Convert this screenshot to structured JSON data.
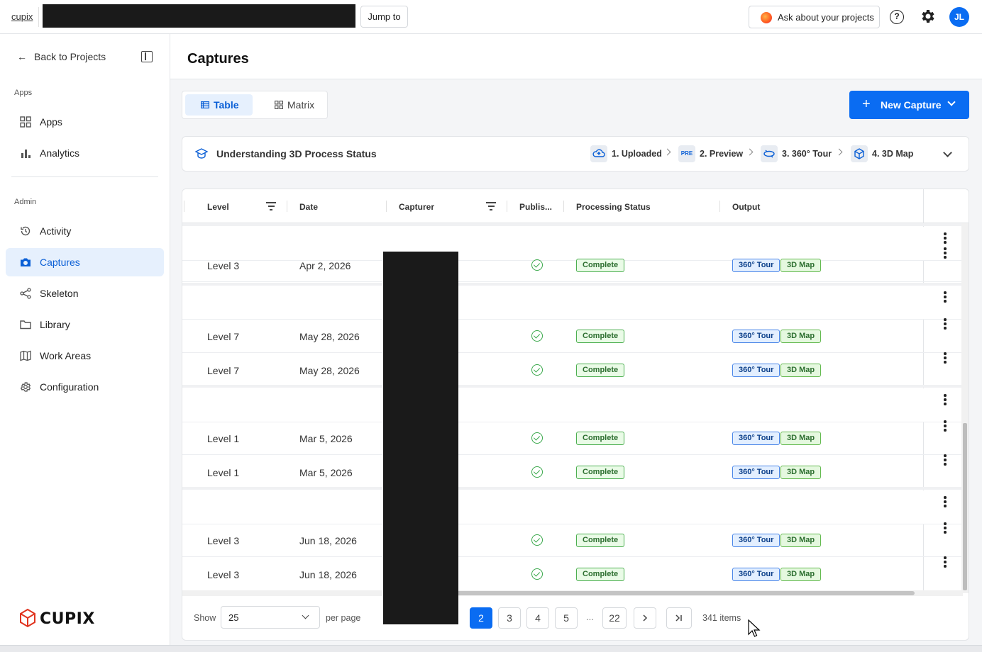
{
  "topbar": {
    "breadcrumb": "cupix",
    "jump_label": "Jump to",
    "ask_label": "Ask about your projects",
    "help_glyph": "?",
    "avatar_initials": "JL"
  },
  "sidebar": {
    "back_label": "Back to Projects",
    "sections": [
      {
        "title": "Apps",
        "items": [
          {
            "label": "Apps",
            "icon": "grid-icon"
          },
          {
            "label": "Analytics",
            "icon": "bar-chart-icon"
          }
        ]
      },
      {
        "title": "Admin",
        "items": [
          {
            "label": "Activity",
            "icon": "history-icon"
          },
          {
            "label": "Captures",
            "icon": "camera-icon",
            "active": true
          },
          {
            "label": "Skeleton",
            "icon": "share-icon"
          },
          {
            "label": "Library",
            "icon": "folder-icon"
          },
          {
            "label": "Work Areas",
            "icon": "map-icon"
          },
          {
            "label": "Configuration",
            "icon": "gear-icon"
          }
        ]
      }
    ],
    "logo_text": "CUPIX"
  },
  "main": {
    "title": "Captures",
    "view_toggle": {
      "table": "Table",
      "matrix": "Matrix",
      "selected": "Table"
    },
    "new_capture_label": "New Capture",
    "process_status": {
      "title": "Understanding 3D Process Status",
      "steps": [
        "1. Uploaded",
        "2. Preview",
        "3. 360° Tour",
        "4. 3D Map"
      ],
      "preview_badge": "PRE"
    },
    "table": {
      "columns": [
        "Level",
        "Date",
        "Capturer",
        "Publis...",
        "Processing Status",
        "Output"
      ],
      "rows": [
        {
          "type": "group"
        },
        {
          "type": "data",
          "level": "Level 3",
          "date": "Apr 2, 2026",
          "status": "Complete",
          "outputs": [
            "360° Tour",
            "3D Map"
          ]
        },
        {
          "type": "group"
        },
        {
          "type": "data",
          "level": "Level 7",
          "date": "May 28, 2026",
          "status": "Complete",
          "outputs": [
            "360° Tour",
            "3D Map"
          ]
        },
        {
          "type": "data",
          "level": "Level 7",
          "date": "May 28, 2026",
          "status": "Complete",
          "outputs": [
            "360° Tour",
            "3D Map"
          ]
        },
        {
          "type": "group"
        },
        {
          "type": "data",
          "level": "Level 1",
          "date": "Mar 5, 2026",
          "status": "Complete",
          "outputs": [
            "360° Tour",
            "3D Map"
          ]
        },
        {
          "type": "data",
          "level": "Level 1",
          "date": "Mar 5, 2026",
          "status": "Complete",
          "outputs": [
            "360° Tour",
            "3D Map"
          ]
        },
        {
          "type": "group"
        },
        {
          "type": "data",
          "level": "Level 3",
          "date": "Jun 18, 2026",
          "status": "Complete",
          "outputs": [
            "360° Tour",
            "3D Map"
          ]
        },
        {
          "type": "data",
          "level": "Level 3",
          "date": "Jun 18, 2026",
          "status": "Complete",
          "outputs": [
            "360° Tour",
            "3D Map"
          ]
        }
      ]
    },
    "pagination": {
      "show_label": "Show",
      "per_page_value": "25",
      "per_page_label": "per page",
      "pages": [
        "2",
        "3",
        "4",
        "5"
      ],
      "current_page": "2",
      "ellipsis": "...",
      "last_page": "22",
      "total_items": "341 items"
    }
  },
  "colors": {
    "accent": "#0a6cf2",
    "active_nav_bg": "#e6f0fd",
    "complete_green": "#4caf50",
    "tour_blue": "#4a86e8"
  }
}
